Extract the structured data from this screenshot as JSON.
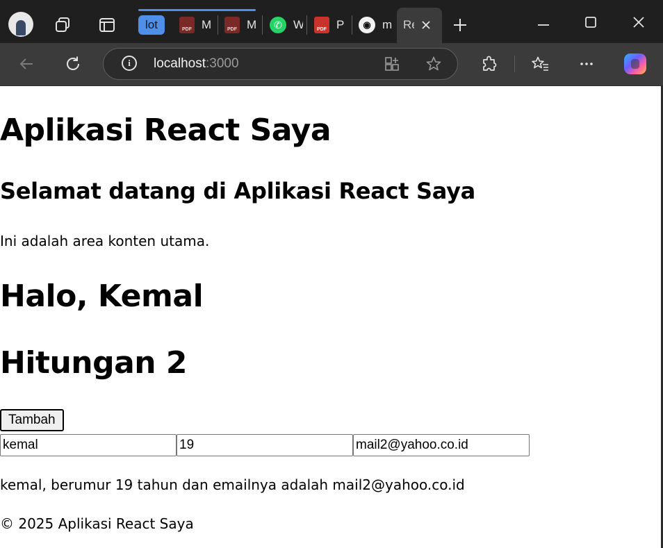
{
  "browser": {
    "tabs": [
      {
        "label": "lot"
      },
      {
        "label": "M"
      },
      {
        "label": "M"
      },
      {
        "label": "W"
      },
      {
        "label": "P"
      },
      {
        "label": "m"
      },
      {
        "label": "Re"
      }
    ],
    "url_host": "localhost",
    "url_port": ":3000"
  },
  "page": {
    "title": "Aplikasi React Saya",
    "welcome": "Selamat datang di Aplikasi React Saya",
    "content_text": "Ini adalah area konten utama.",
    "greeting": "Halo, Kemal",
    "counter_text": "Hitungan 2",
    "add_button": "Tambah",
    "form": {
      "name_value": "kemal",
      "age_value": "19",
      "email_value": "mail2@yahoo.co.id"
    },
    "summary": "kemal, berumur 19 tahun dan emailnya adalah mail2@yahoo.co.id",
    "footer": "© 2025 Aplikasi React Saya"
  }
}
